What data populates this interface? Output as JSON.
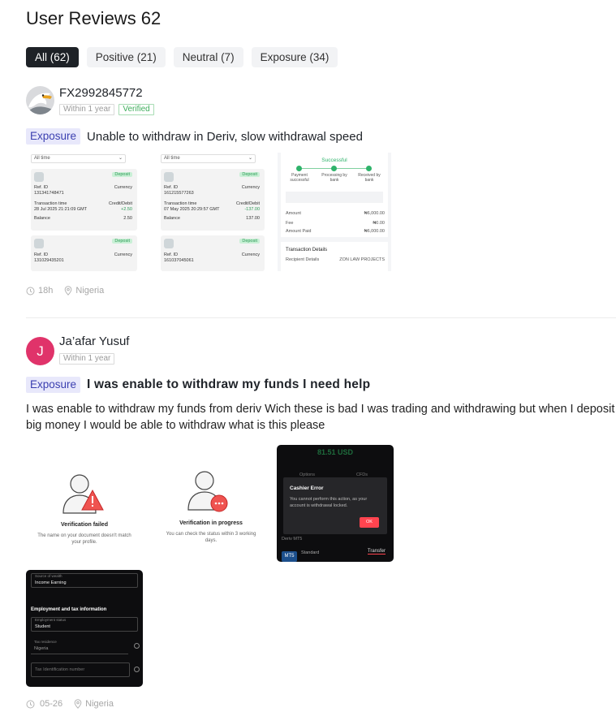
{
  "page": {
    "title": "User Reviews 62"
  },
  "filters": [
    {
      "label": "All (62)",
      "active": true
    },
    {
      "label": "Positive (21)",
      "active": false
    },
    {
      "label": "Neutral (7)",
      "active": false
    },
    {
      "label": "Exposure (34)",
      "active": false
    }
  ],
  "reviews": [
    {
      "username": "FX2992845772",
      "duration_badge": "Within 1 year",
      "verified_badge": "Verified",
      "tag": "Exposure",
      "title": "Unable to withdraw in Deriv, slow withdrawal speed",
      "body": "",
      "time": "18h",
      "location": "Nigeria",
      "images": {
        "shot1": {
          "filter": "All time",
          "cards": [
            {
              "status": "Deposit",
              "ref_label": "Ref. ID",
              "ref": "131341748471",
              "currency_label": "Currency",
              "time_label": "Transaction time",
              "time": "28 Jul 2025 21:21:09 GMT",
              "credit_label": "Credit/Debit",
              "credit": "+2.50",
              "balance_label": "Balance",
              "balance": "2.50"
            },
            {
              "status": "Deposit",
              "ref_label": "Ref. ID",
              "ref": "131029435201",
              "currency_label": "Currency"
            }
          ]
        },
        "shot2": {
          "filter": "All time",
          "cards": [
            {
              "status": "Deposit",
              "ref_label": "Ref. ID",
              "ref": "161215577263",
              "currency_label": "Currency",
              "time_label": "Transaction time",
              "time": "07 May 2025 20:29:57 GMT",
              "credit_label": "Credit/Debit",
              "credit": "-137.00",
              "balance_label": "Balance",
              "balance": "137.00"
            },
            {
              "status": "Deposit",
              "ref_label": "Ref. ID",
              "ref": "161037045061",
              "currency_label": "Currency"
            }
          ]
        },
        "shot3": {
          "status": "Successful",
          "steps": [
            "Payment successful",
            "Processing by bank",
            "Received by bank"
          ],
          "amount_label": "Amount",
          "amount": "₦6,000.00",
          "fee_label": "Fee",
          "fee": "₦0.00",
          "paid_label": "Amount Paid",
          "paid": "₦6,000.00",
          "details_title": "Transaction Details",
          "recipient_label": "Recipient Details",
          "recipient": "ZON LAW PROJECTS"
        }
      }
    },
    {
      "username": "Ja’afar Yusuf",
      "avatar_letter": "J",
      "duration_badge": "Within 1 year",
      "tag": "Exposure",
      "title": "I was enable to withdraw my funds I need help",
      "body": "I was enable to withdraw my funds from deriv Wich these is bad I was trading and withdrawing but when I deposit big money I would be able to withdraw what is this please",
      "time": "05-26",
      "location": "Nigeria",
      "images": {
        "shot1": {
          "title": "Verification failed",
          "desc": "The name on your document doesn't match your profile."
        },
        "shot2": {
          "title": "Verification in progress",
          "desc": "You can check the status within 3 working days."
        },
        "shot3": {
          "balance": "81.51 USD",
          "tab_left": "Options",
          "tab_right": "CFDs",
          "dialog_title": "Cashier Error",
          "dialog_text": "You cannot perform this action, as your account is withdrawal locked.",
          "ok": "OK",
          "account_label": "Deriv MT5",
          "account_name": "Standard",
          "transfer": "Transfer"
        },
        "shot4": {
          "field1_label": "Source of wealth",
          "field1": "Income Earning",
          "section": "Employment and tax information",
          "field2_label": "Employment status",
          "field2": "Student",
          "field3_label": "Tax residence",
          "field3": "Nigeria",
          "field4_placeholder": "Tax Identification number"
        }
      }
    }
  ]
}
